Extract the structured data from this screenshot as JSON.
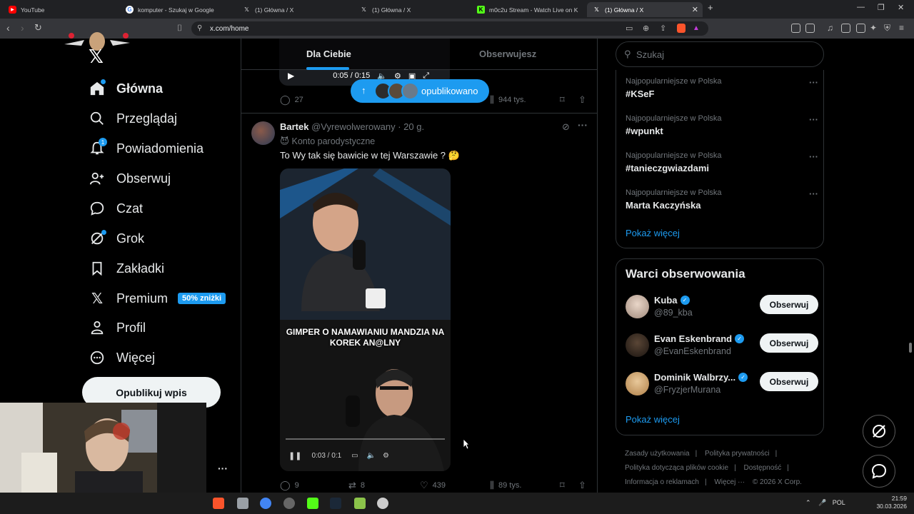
{
  "browser": {
    "tabs": [
      {
        "label": "YouTube",
        "icon": "youtube-icon",
        "color": "#ff0000"
      },
      {
        "label": "komputer - Szukaj w Google",
        "icon": "google-icon",
        "color": "#ffffff"
      },
      {
        "label": "(1) Główna / X",
        "icon": "x-icon",
        "color": "#ffffff"
      },
      {
        "label": "(1) Główna / X",
        "icon": "x-icon",
        "color": "#ffffff"
      },
      {
        "label": "m0c2u Stream - Watch Live on K",
        "icon": "kick-icon",
        "color": "#53fc18"
      },
      {
        "label": "(1) Główna / X",
        "icon": "x-icon",
        "color": "#ffffff"
      }
    ],
    "new_tab": "+",
    "url": "x.com/home"
  },
  "nav": {
    "items": [
      {
        "label": "Główna",
        "icon": "home-icon"
      },
      {
        "label": "Przeglądaj",
        "icon": "search-icon"
      },
      {
        "label": "Powiadomienia",
        "icon": "bell-icon",
        "badge": "1"
      },
      {
        "label": "Obserwuj",
        "icon": "follow-icon"
      },
      {
        "label": "Czat",
        "icon": "chat-icon"
      },
      {
        "label": "Grok",
        "icon": "grok-icon"
      },
      {
        "label": "Zakładki",
        "icon": "bookmark-icon"
      },
      {
        "label": "Premium",
        "icon": "x-icon"
      },
      {
        "label": "Profil",
        "icon": "profile-icon"
      },
      {
        "label": "Więcej",
        "icon": "more-icon"
      }
    ],
    "premium_badge": "50% zniżki",
    "post_button": "Opublikuj wpis",
    "more_dots": "···"
  },
  "feed": {
    "tabs": [
      "Dla Ciebie",
      "Obserwujesz"
    ],
    "prev_video": {
      "time": "0:05 / 0:15"
    },
    "new_posts_pill": "opublikowano",
    "prev_actions": {
      "replies": "27",
      "views": "944 tys."
    },
    "tweet": {
      "name": "Bartek",
      "handle": "@Vyrewolwerowany",
      "time": "· 20 g.",
      "parody": "Konto parodystyczne",
      "text": "To Wy tak się bawicie w tej Warszawie ? 🤔",
      "video_caption": "GIMPER O NAMAWIANIU MANDZIA NA KOREK AN@LNY",
      "video_time": "0:03 / 0:1",
      "replies": "9",
      "reposts": "8",
      "likes": "439",
      "views": "89 tys."
    }
  },
  "right": {
    "search_placeholder": "Szukaj",
    "trends": [
      {
        "context": "Najpopularniejsze w Polska",
        "topic": "#KSeF"
      },
      {
        "context": "Najpopularniejsze w Polska",
        "topic": "#wpunkt"
      },
      {
        "context": "Najpopularniejsze w Polska",
        "topic": "#tanieczgwiazdami"
      },
      {
        "context": "Najpopularniejsze w Polska",
        "topic": "Marta Kaczyńska"
      }
    ],
    "trends_show_more": "Pokaż więcej",
    "wtf_title": "Warci obserwowania",
    "wtf": [
      {
        "name": "Kuba",
        "handle": "@89_kba",
        "button": "Obserwuj"
      },
      {
        "name": "Evan Eskenbrand",
        "handle": "@EvanEskenbrand",
        "button": "Obserwuj"
      },
      {
        "name": "Dominik Walbrzy...",
        "handle": "@FryzjerMurana",
        "button": "Obserwuj"
      }
    ],
    "wtf_show_more": "Pokaż więcej",
    "footer": [
      "Zasady użytkowania",
      "|",
      "Polityka prywatności",
      "|",
      "Polityka dotycząca plików cookie",
      "|",
      "Dostępność",
      "|",
      "Informacja o reklamach",
      "|",
      "Więcej ···",
      "© 2026 X Corp."
    ]
  },
  "taskbar": {
    "lang": "POL",
    "time": "21:59",
    "date": "30.03.2026"
  },
  "colors": {
    "accent": "#1d9bf0",
    "background": "#000000",
    "border": "#2f3336"
  }
}
